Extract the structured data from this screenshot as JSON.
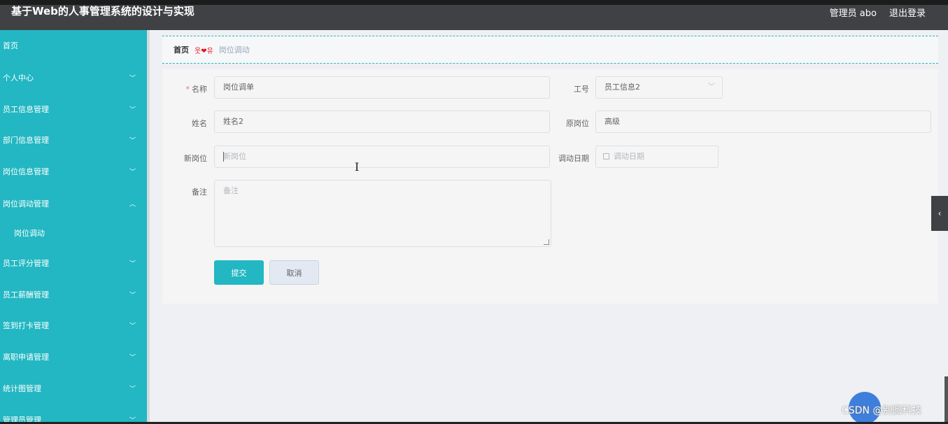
{
  "header": {
    "title": "基于Web的人事管理系统的设计与实现",
    "user": "管理员 abo",
    "logout": "退出登录"
  },
  "sidebar": {
    "items": [
      {
        "label": "首页",
        "chevron": ""
      },
      {
        "label": "个人中心",
        "chevron": "﹀"
      },
      {
        "label": "员工信息管理",
        "chevron": "﹀"
      },
      {
        "label": "部门信息管理",
        "chevron": "﹀"
      },
      {
        "label": "岗位信息管理",
        "chevron": "﹀"
      },
      {
        "label": "岗位调动管理",
        "chevron": "︿"
      },
      {
        "label": "岗位调动",
        "chevron": ""
      },
      {
        "label": "员工评分管理",
        "chevron": "﹀"
      },
      {
        "label": "员工薪酬管理",
        "chevron": "﹀"
      },
      {
        "label": "签到打卡管理",
        "chevron": "﹀"
      },
      {
        "label": "离职申请管理",
        "chevron": "﹀"
      },
      {
        "label": "统计图管理",
        "chevron": "﹀"
      },
      {
        "label": "管理员管理",
        "chevron": "﹀"
      }
    ]
  },
  "breadcrumb": {
    "home": "首页",
    "separator": "웃❤유",
    "current": "岗位调动"
  },
  "form": {
    "name_label": "名称",
    "required_mark": "*",
    "name_value": "岗位调单",
    "employee_no_label": "工号",
    "employee_no_value": "员工信息2",
    "full_name_label": "姓名",
    "full_name_value": "姓名2",
    "original_post_label": "原岗位",
    "original_post_value": "高级",
    "new_post_label": "新岗位",
    "new_post_placeholder": "新岗位",
    "transfer_date_label": "调动日期",
    "transfer_date_placeholder": "调动日期",
    "remark_label": "备注",
    "remark_placeholder": "备注",
    "submit": "提交",
    "cancel": "取消"
  },
  "collapse_tab_icon": "‹",
  "watermark": "CSDN @别圆科技",
  "colors": {
    "accent": "#22b7c2",
    "topbar": "#3f4145",
    "required": "#f56c6c"
  }
}
